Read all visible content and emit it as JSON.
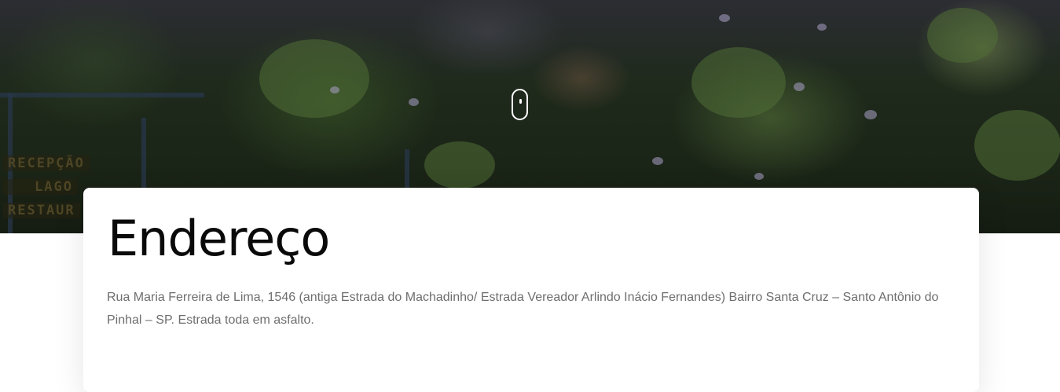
{
  "hero": {
    "sign_lines": [
      "RECEPÇÃO",
      "LAGO",
      "RESTAUR"
    ],
    "scroll_icon": "scroll-down-mouse-icon"
  },
  "address_card": {
    "title": "Endereço",
    "text": "Rua Maria Ferreira de Lima, 1546 (antiga Estrada do Machadinho/ Estrada Vereador Arlindo Inácio Fernandes) Bairro Santa Cruz – Santo Antônio do Pinhal – SP. Estrada toda em asfalto."
  },
  "colors": {
    "title": "#0a0a0a",
    "body_text": "#6e6e6e",
    "card_background": "#ffffff"
  }
}
